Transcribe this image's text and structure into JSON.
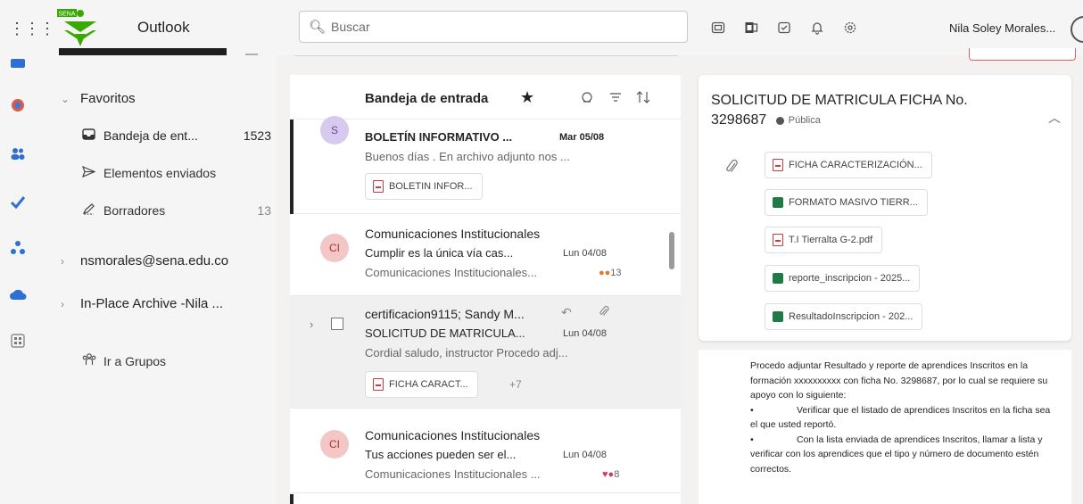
{
  "header": {
    "app_name": "Outlook",
    "search_placeholder": "Buscar",
    "user_name": "Nila Soley Morales..."
  },
  "folders": {
    "favorites_label": "Favoritos",
    "items": [
      {
        "label": "Bandeja de ent...",
        "count": "1523",
        "icon": "inbox-icon"
      },
      {
        "label": "Elementos enviados",
        "count": "",
        "icon": "send-icon"
      },
      {
        "label": "Borradores",
        "count": "13",
        "icon": "draft-icon"
      }
    ],
    "account_label": "nsmorales@sena.edu.co",
    "archive_label": "In-Place Archive -Nila ...",
    "groups_label": "Ir a Grupos"
  },
  "message_list": {
    "title": "Bandeja de entrada",
    "messages": [
      {
        "avatar": "S",
        "subject": "BOLETÍN INFORMATIVO ...",
        "date": "Mar 05/08",
        "preview": "Buenos días . En archivo adjunto nos ...",
        "attachment": "BOLETIN INFOR..."
      },
      {
        "avatar": "CI",
        "sender": "Comunicaciones Institucionales",
        "subject": "Cumplir es la única vía cas...",
        "date": "Lun 04/08",
        "preview": "Comunicaciones Institucionales...",
        "reactions": "13"
      },
      {
        "sender": "certificacion9115; Sandy M...",
        "subject": "SOLICITUD DE MATRICULA...",
        "date": "Lun 04/08",
        "preview": "Cordial saludo, instructor Procedo adj...",
        "attachment": "FICHA CARACT...",
        "extra_attachments": "+7"
      },
      {
        "avatar": "CI",
        "sender": "Comunicaciones Institucionales",
        "subject": "Tus acciones pueden ser el...",
        "date": "Lun 04/08",
        "preview": "Comunicaciones Institucionales ...",
        "reactions": "8"
      }
    ]
  },
  "reading_pane": {
    "title": "SOLICITUD DE MATRICULA FICHA No. 3298687",
    "visibility": "Pública",
    "attachments": [
      {
        "name": "FICHA CARACTERIZACIÓN...",
        "type": "pdf"
      },
      {
        "name": "FORMATO MASIVO TIERR...",
        "type": "excel"
      },
      {
        "name": "T.I Tierralta G-2.pdf",
        "type": "pdf"
      },
      {
        "name": "reporte_inscripcion - 2025...",
        "type": "excel"
      },
      {
        "name": "ResultadoInscripcion - 202...",
        "type": "excel"
      }
    ],
    "body": {
      "intro": "Procedo adjuntar Resultado y reporte de aprendices Inscritos en la formación xxxxxxxxxx con ficha No. 3298687, por lo cual se requiere su apoyo con lo siguiente:",
      "bullets": [
        "Verificar que el listado de aprendices Inscritos en la ficha sea el que usted reportó.",
        "Con la lista enviada de aprendices Inscritos, llamar a lista y verificar con los aprendices que el tipo y número de documento estén correctos."
      ],
      "bullet_char": "•"
    }
  },
  "colors": {
    "sena_green": "#39a900",
    "avatar_s": "#d8c9ef",
    "avatar_ci": "#f4c7c7"
  }
}
